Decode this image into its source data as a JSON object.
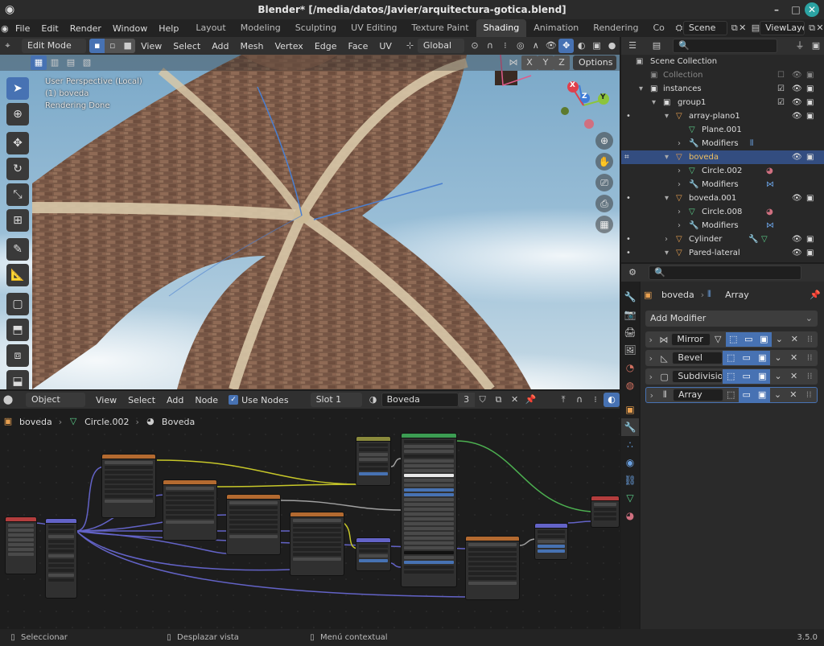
{
  "window": {
    "title": "Blender* [/media/datos/Javier/arquitectura-gotica.blend]"
  },
  "menu": [
    "File",
    "Edit",
    "Render",
    "Window",
    "Help"
  ],
  "workspaces": [
    "Layout",
    "Modeling",
    "Sculpting",
    "UV Editing",
    "Texture Paint",
    "Shading",
    "Animation",
    "Rendering",
    "Co"
  ],
  "scene": {
    "name": "Scene",
    "view_layer": "ViewLayer"
  },
  "viewport_header": {
    "mode": "Edit Mode",
    "menus": [
      "View",
      "Select",
      "Add",
      "Mesh",
      "Vertex",
      "Edge",
      "Face",
      "UV"
    ],
    "transform": "Global",
    "axes": [
      "X",
      "Y",
      "Z"
    ],
    "options": "Options"
  },
  "viewport": {
    "info_line1": "User Perspective (Local)",
    "info_line2": "(1) boveda",
    "info_line3": "Rendering Done",
    "gizmo": {
      "x": "X",
      "y": "Y",
      "z": "Z"
    }
  },
  "node_header": {
    "type": "Object",
    "menus": [
      "View",
      "Select",
      "Add",
      "Node"
    ],
    "use_nodes": "Use Nodes",
    "slot": "Slot 1",
    "material": "Boveda",
    "users": "3"
  },
  "breadcrumb": {
    "object": "boveda",
    "mesh": "Circle.002",
    "material": "Boveda"
  },
  "outliner": {
    "items": [
      {
        "label": "Scene Collection",
        "level": 0
      },
      {
        "label": "Collection",
        "level": 1,
        "dim": true
      },
      {
        "label": "instances",
        "level": 1
      },
      {
        "label": "group1",
        "level": 2
      },
      {
        "label": "array-plano1",
        "level": 3
      },
      {
        "label": "Plane.001",
        "level": 4
      },
      {
        "label": "Modifiers",
        "level": 4
      },
      {
        "label": "boveda",
        "level": 3,
        "selected": true
      },
      {
        "label": "Circle.002",
        "level": 4
      },
      {
        "label": "Modifiers",
        "level": 4
      },
      {
        "label": "boveda.001",
        "level": 3
      },
      {
        "label": "Circle.008",
        "level": 4
      },
      {
        "label": "Modifiers",
        "level": 4
      },
      {
        "label": "Cylinder",
        "level": 3
      },
      {
        "label": "Pared-lateral",
        "level": 3
      }
    ]
  },
  "properties": {
    "object": "boveda",
    "modifier": "Array",
    "add_modifier": "Add Modifier",
    "modifiers": [
      "Mirror",
      "Bevel",
      "Subdivision",
      "Array"
    ]
  },
  "status_bar": {
    "select": "Seleccionar",
    "pan": "Desplazar vista",
    "context": "Menú contextual",
    "version": "3.5.0"
  },
  "colors": {
    "accent": "#4772b3",
    "selected_row": "#334d80",
    "header": "#303030"
  }
}
